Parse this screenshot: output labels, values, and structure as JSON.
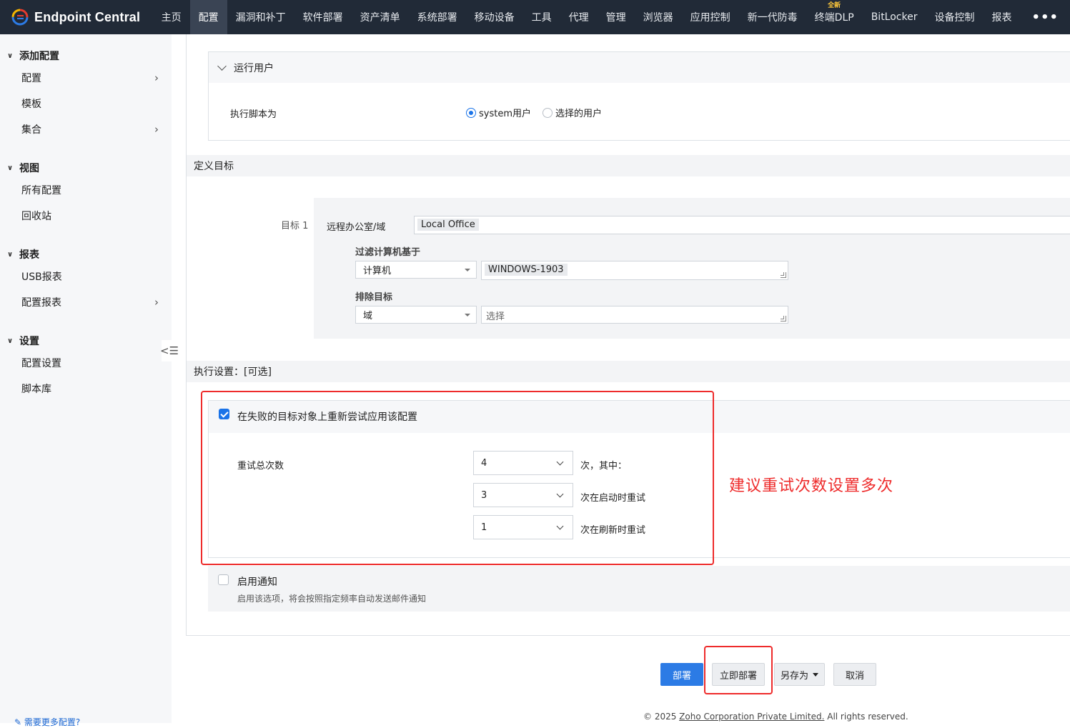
{
  "app": {
    "title": "Endpoint Central"
  },
  "colors": {
    "nav_bg": "#212a37",
    "accent": "#2c7be5",
    "annotation": "#ee2b2b",
    "badge": "#ffc93a"
  },
  "nav": {
    "items": [
      {
        "label": "主页"
      },
      {
        "label": "配置",
        "active": true
      },
      {
        "label": "漏洞和补丁"
      },
      {
        "label": "软件部署"
      },
      {
        "label": "资产清单"
      },
      {
        "label": "系统部署"
      },
      {
        "label": "移动设备"
      },
      {
        "label": "工具"
      },
      {
        "label": "代理"
      },
      {
        "label": "管理"
      },
      {
        "label": "浏览器"
      },
      {
        "label": "应用控制"
      },
      {
        "label": "新一代防毒"
      },
      {
        "label": "终端DLP",
        "badge": "全新"
      },
      {
        "label": "BitLocker"
      },
      {
        "label": "设备控制"
      },
      {
        "label": "报表"
      }
    ],
    "more": "•••"
  },
  "sidebar": {
    "groups": [
      {
        "title": "添加配置",
        "items": [
          {
            "label": "配置",
            "has_sub": true
          },
          {
            "label": "模板"
          },
          {
            "label": "集合",
            "has_sub": true
          }
        ]
      },
      {
        "title": "视图",
        "items": [
          {
            "label": "所有配置"
          },
          {
            "label": "回收站"
          }
        ]
      },
      {
        "title": "报表",
        "items": [
          {
            "label": "USB报表"
          },
          {
            "label": "配置报表",
            "has_sub": true
          }
        ]
      },
      {
        "title": "设置",
        "items": [
          {
            "label": "配置设置"
          },
          {
            "label": "脚本库"
          }
        ]
      }
    ],
    "footer": "需要更多配置?"
  },
  "run_user": {
    "title": "运行用户",
    "label": "执行脚本为",
    "options": [
      {
        "label": "system用户",
        "selected": true
      },
      {
        "label": "选择的用户",
        "selected": false
      }
    ]
  },
  "define_target": {
    "title": "定义目标",
    "target_label": "目标 1",
    "remote_office_label": "远程办公室/域",
    "remote_office_value": "Local Office",
    "filter_label": "过滤计算机基于",
    "filter_type": "计算机",
    "filter_value": "WINDOWS-1903",
    "exclude_label": "排除目标",
    "exclude_type": "域",
    "exclude_placeholder": "选择"
  },
  "exec_settings": {
    "title": "执行设置：[可选]",
    "retry": {
      "checked": true,
      "label": "在失败的目标对象上重新尝试应用该配置",
      "total_label": "重试总次数",
      "rows": [
        {
          "value": "4",
          "suffix": "次，其中："
        },
        {
          "value": "3",
          "suffix": "次在启动时重试"
        },
        {
          "value": "1",
          "suffix": "次在刷新时重试"
        }
      ]
    },
    "notify": {
      "checked": false,
      "label": "启用通知",
      "desc": "启用该选项，将会按照指定频率自动发送邮件通知"
    }
  },
  "annotation": "建议重试次数设置多次",
  "buttons": {
    "deploy": "部署",
    "deploy_now": "立即部署",
    "save_as": "另存为",
    "cancel": "取消"
  },
  "footer": {
    "prefix": "© 2025 ",
    "company": "Zoho Corporation Private Limited.",
    "suffix": " All rights reserved."
  }
}
